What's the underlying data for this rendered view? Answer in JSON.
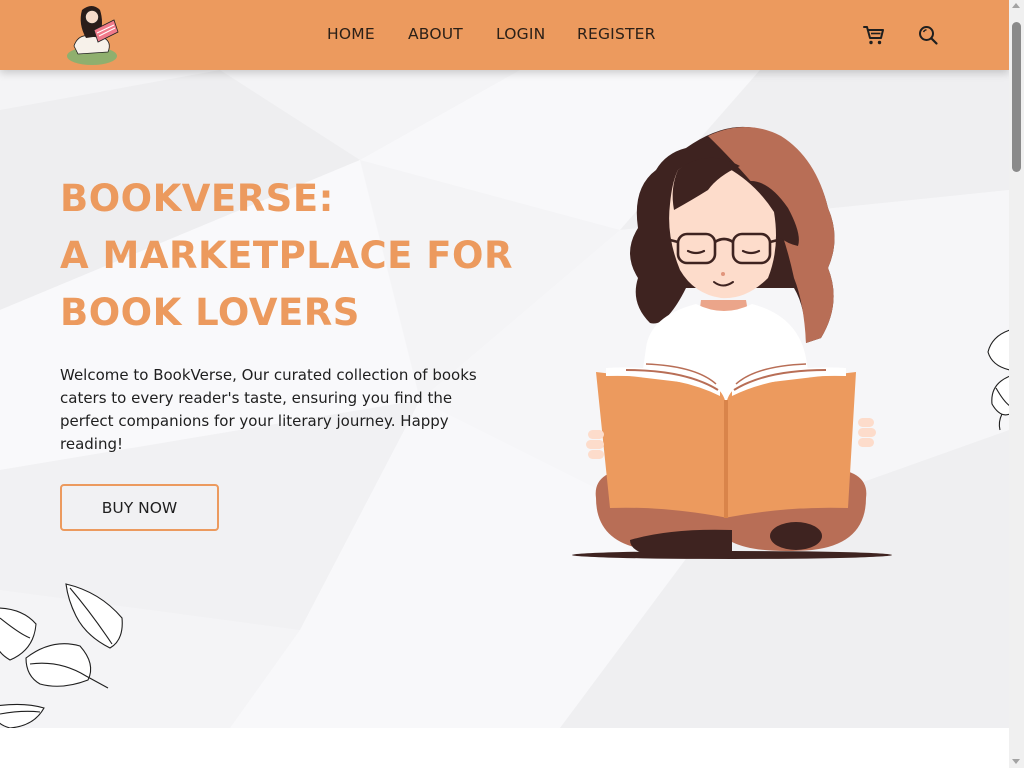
{
  "nav": {
    "items": [
      "HOME",
      "ABOUT",
      "LOGIN",
      "REGISTER"
    ],
    "cart_icon": "cart-icon",
    "search_icon": "search-icon",
    "logo_icon": "reading-girl-logo"
  },
  "hero": {
    "title_lines": [
      "BOOKVERSE:",
      "A MARKETPLACE FOR",
      "BOOK LOVERS"
    ],
    "description": "Welcome to BookVerse, Our curated collection of books caters to every reader's taste, ensuring you find the perfect companions for your literary journey. Happy reading!",
    "cta_label": "BUY NOW",
    "illustration_icon": "girl-reading-book-illustration",
    "decoration_icon": "leaves-sketch"
  },
  "colors": {
    "accent": "#EC9A5E",
    "header_bg": "#EC9A5E",
    "hero_bg": "#F4F4F6",
    "text": "#1F1F1F",
    "hair_dark": "#3E2320",
    "hair_light": "#B86E56",
    "skin": "#FDDCCB"
  }
}
